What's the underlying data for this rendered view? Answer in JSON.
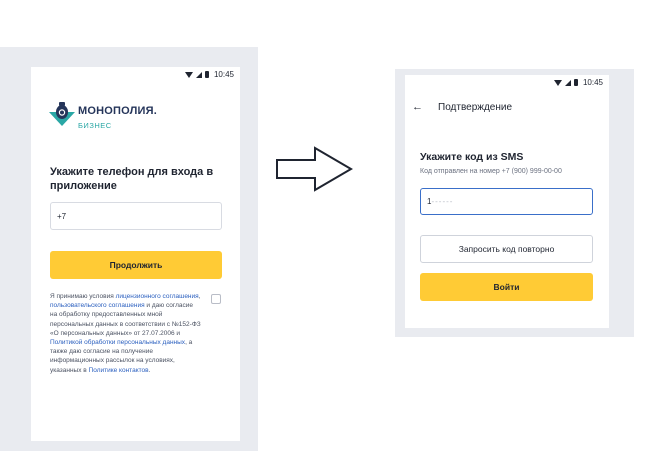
{
  "status_bar": {
    "time": "10:45"
  },
  "login_screen": {
    "brand": {
      "name": "МОНОПОЛИЯ.",
      "subtitle": "БИЗНЕС"
    },
    "heading": "Укажите телефон для входа в приложение",
    "phone_input": {
      "value": "+7"
    },
    "continue_label": "Продолжить",
    "consent": {
      "t1": "Я принимаю условия ",
      "link1": "лицензионного соглашения",
      "t2": ", ",
      "link2": "пользовательского соглашения",
      "t3": " и даю согласие на обработку предоставленных мной персональных данных в соответствии с №152-ФЗ «О персональных данных» от 27.07.2006 и ",
      "link3": "Политикой обработки персональных данных",
      "t4": ", а также даю согласие на получение информационных рассылок на условиях, указанных в ",
      "link4": "Политике контактов",
      "t5": "."
    },
    "consent_checked": false
  },
  "confirm_screen": {
    "title": "Подтверждение",
    "heading": "Укажите код из SMS",
    "subtext": "Код отправлен на номер +7 (900) 999-00-00",
    "code_input": {
      "value": "1",
      "placeholder": "------"
    },
    "resend_label": "Запросить код повторно",
    "login_label": "Войти"
  },
  "colors": {
    "accent_yellow": "#ffcb35",
    "link_blue": "#2a5fbf",
    "focus_blue": "#3a6fc9",
    "brand_navy": "#25355a",
    "brand_teal": "#2aa7a5"
  },
  "icons": {
    "status": [
      "wifi-icon",
      "signal-icon",
      "battery-icon"
    ],
    "back": "arrow-left-icon",
    "flow": "arrow-right-outline-icon"
  }
}
